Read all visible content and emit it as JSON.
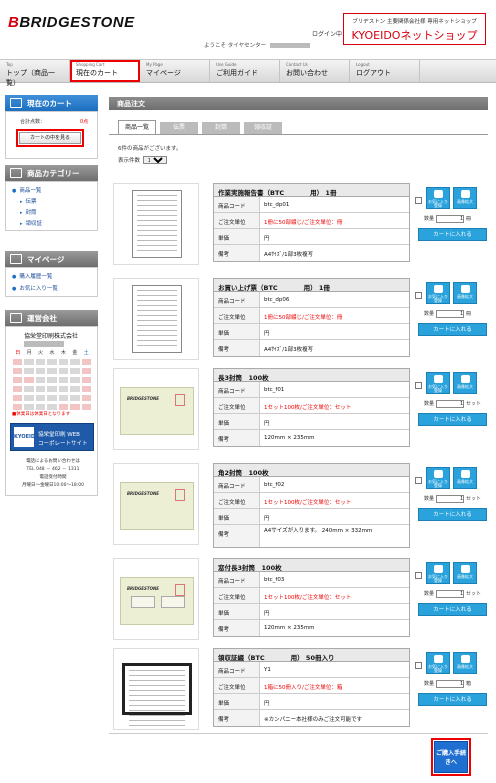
{
  "header": {
    "logo_text": "BRIDGESTONE",
    "login_label": "ログイン中",
    "welcome_text": "ようこそ  タイヤセンター",
    "shop_sub": "ブリヂストン 主要関係会社様 専用ネットショップ",
    "shop_name": "KYOEIDOネットショップ"
  },
  "nav": [
    {
      "en": "Top",
      "jp": "トップ（商品一覧）"
    },
    {
      "en": "Shopping Cart",
      "jp": "現在のカート"
    },
    {
      "en": "My Page",
      "jp": "マイページ"
    },
    {
      "en": "Use Guide",
      "jp": "ご利用ガイド"
    },
    {
      "en": "Contact Us",
      "jp": "お問い合わせ"
    },
    {
      "en": "Logout",
      "jp": "ログアウト"
    }
  ],
  "sidebar": {
    "cart": {
      "title": "現在のカート",
      "total_label": "合計点数：",
      "total_value": "0点",
      "view_button": "カートの中を見る"
    },
    "category": {
      "title": "商品カテゴリー",
      "items": [
        "商品一覧",
        "伝票",
        "封筒",
        "領収証"
      ]
    },
    "mypage": {
      "title": "マイページ",
      "items": [
        "購入履歴一覧",
        "お気に入り一覧"
      ]
    },
    "company": {
      "title": "運営会社",
      "name": "協栄堂印刷株式会社",
      "dow": [
        "日",
        "月",
        "火",
        "水",
        "木",
        "金",
        "土"
      ],
      "note": "■休業日は休業日となります",
      "banner_logo": "KYOEIDO",
      "banner_line1": "協栄堂印刷 WEB",
      "banner_line2": "コーポレートサイト",
      "contact": [
        "電話によるお問い合わせは",
        "TEL 048 － 462 － 1311",
        "電話受付時間",
        "月曜日～金曜日10:00～18:00"
      ]
    }
  },
  "main": {
    "title": "商品注文",
    "tabs": [
      "商品一覧",
      "伝票",
      "封筒",
      "領収証"
    ],
    "summary": "6件の商品がございます。",
    "perpage_label": "表示件数",
    "perpage_value": "15件",
    "labels": {
      "code": "商品コード",
      "unit": "ご注文単位",
      "price": "単価",
      "note": "備考",
      "qty": "数量",
      "unit_set": "セット",
      "unit_book": "冊"
    },
    "buttons": {
      "favorite": "お気に入り登録",
      "zoom": "画像拡大",
      "add_cart": "カートに入れる"
    },
    "products": [
      {
        "title": "作業実施報告書（BTC　　　　用） 1冊",
        "code": "btc_dp01",
        "unit": "1冊に50部綴じ/ご注文単位：冊",
        "price": "円",
        "note": "A4ｻｲｽﾞ/1部3枚複写",
        "qty": "1",
        "qty_unit": "冊"
      },
      {
        "title": "お買い上げ票（BTC　　　　用） 1冊",
        "code": "btc_dp06",
        "unit": "1冊に50部綴じ/ご注文単位：冊",
        "price": "円",
        "note": "A4ｻｲｽﾞ/1部3枚複写",
        "qty": "1",
        "qty_unit": "冊"
      },
      {
        "title": "長3封筒　100枚",
        "code": "btc_f01",
        "unit": "1セット100枚/ご注文単位：セット",
        "price": "円",
        "note": "120mm × 235mm",
        "qty": "1",
        "qty_unit": "セット"
      },
      {
        "title": "角2封筒　100枚",
        "code": "btc_f02",
        "unit": "1セット100枚/ご注文単位：セット",
        "price": "円",
        "note": "A4サイズが入ります。 240mm × 332mm",
        "qty": "1",
        "qty_unit": "セット"
      },
      {
        "title": "窓付長3封筒　100枚",
        "code": "btc_f03",
        "unit": "1セット100枚/ご注文単位：セット",
        "price": "円",
        "note": "120mm × 235mm",
        "qty": "1",
        "qty_unit": "セット"
      },
      {
        "title": "領収証綴（BTC　　　　用） 50冊入り",
        "code": "Y1",
        "unit": "1箱に50冊入り/ご注文単位：箱",
        "price": "円",
        "note": "※カンパニー本社様のみご注文可能です",
        "qty": "1",
        "qty_unit": "箱"
      }
    ],
    "checkout": "ご購入手続きへ"
  },
  "colors": {
    "brand_red": "#d6000f",
    "accent_blue": "#2aa2dc",
    "highlight": "#ee0000"
  }
}
